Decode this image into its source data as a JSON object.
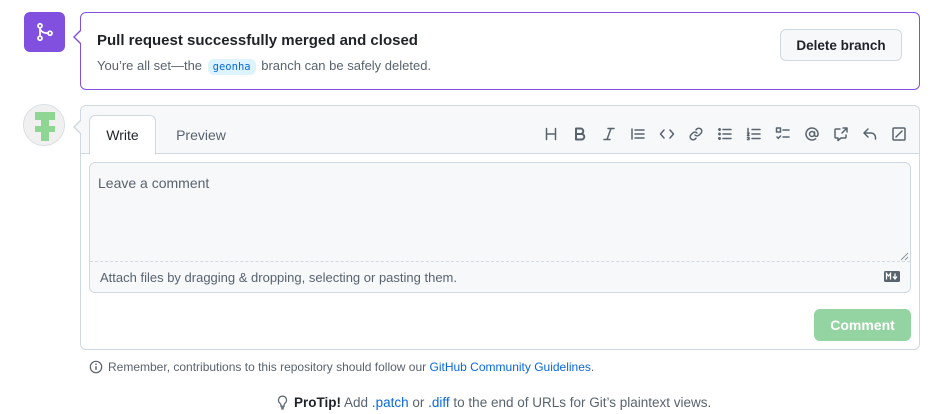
{
  "merge_banner": {
    "title": "Pull request successfully merged and closed",
    "subtitle_prefix": "You’re all set—the",
    "branch_name": "geonha",
    "subtitle_suffix": "branch can be safely deleted.",
    "delete_button_label": "Delete branch",
    "icon": "git-merge-icon",
    "accent_color": "#8250df"
  },
  "comment_form": {
    "tabs": [
      {
        "label": "Write",
        "active": true
      },
      {
        "label": "Preview",
        "active": false
      }
    ],
    "toolbar_icons": [
      "heading-icon",
      "bold-icon",
      "italic-icon",
      "quote-icon",
      "code-icon",
      "link-icon",
      "bulleted-list-icon",
      "numbered-list-icon",
      "task-list-icon",
      "mention-icon",
      "cross-reference-icon",
      "saved-reply-icon",
      "fullscreen-icon"
    ],
    "placeholder": "Leave a comment",
    "attach_hint": "Attach files by dragging & dropping, selecting or pasting them.",
    "submit_label": "Comment",
    "submit_color": "#94d3a2"
  },
  "reminder": {
    "text": "Remember, contributions to this repository should follow our",
    "link_text": "GitHub Community Guidelines",
    "suffix": "."
  },
  "protip": {
    "label": "ProTip!",
    "text_1": "Add",
    "link_1": ".patch",
    "text_2": "or",
    "link_2": ".diff",
    "text_3": "to the end of URLs for Git’s plaintext views."
  }
}
